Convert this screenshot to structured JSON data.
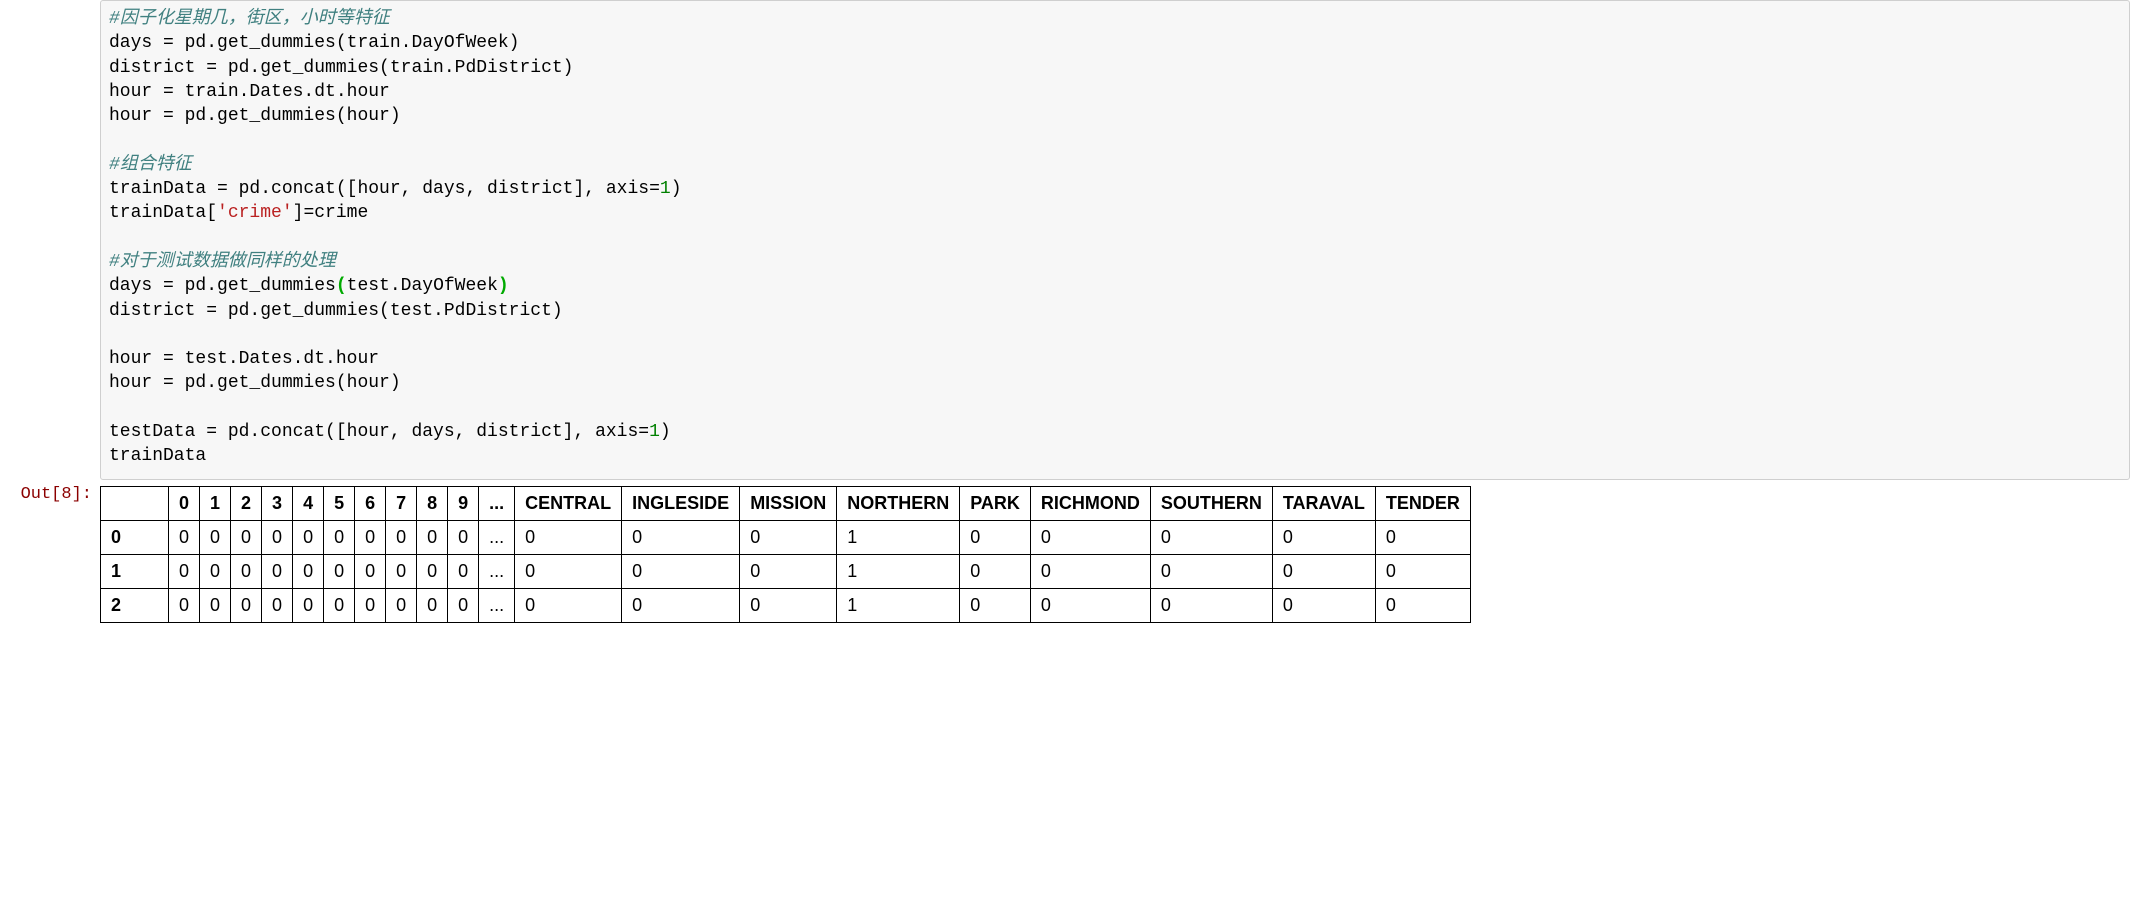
{
  "code": {
    "lines": [
      {
        "type": "comment",
        "text": "#因子化星期几，街区，小时等特征"
      },
      {
        "type": "plain",
        "text": "days = pd.get_dummies(train.DayOfWeek)"
      },
      {
        "type": "plain",
        "text": "district = pd.get_dummies(train.PdDistrict)"
      },
      {
        "type": "plain",
        "text": "hour = train.Dates.dt.hour"
      },
      {
        "type": "plain",
        "text": "hour = pd.get_dummies(hour)"
      },
      {
        "type": "blank",
        "text": ""
      },
      {
        "type": "comment",
        "text": "#组合特征"
      },
      {
        "type": "concat1",
        "pre": "trainData = pd.concat([hour, days, district], axis=",
        "num": "1",
        "post": ")"
      },
      {
        "type": "crime",
        "pre": "trainData[",
        "str": "'crime'",
        "post": "]=crime"
      },
      {
        "type": "blank",
        "text": ""
      },
      {
        "type": "comment",
        "text": "#对于测试数据做同样的处理"
      },
      {
        "type": "hlparen",
        "pre": "days = pd.get_dummies",
        "open": "(",
        "mid": "test.DayOfWeek",
        "close": ")"
      },
      {
        "type": "plain",
        "text": "district = pd.get_dummies(test.PdDistrict)"
      },
      {
        "type": "blank",
        "text": ""
      },
      {
        "type": "plain",
        "text": "hour = test.Dates.dt.hour"
      },
      {
        "type": "plain",
        "text": "hour = pd.get_dummies(hour)"
      },
      {
        "type": "blank",
        "text": ""
      },
      {
        "type": "concat1",
        "pre": "testData = pd.concat([hour, days, district], axis=",
        "num": "1",
        "post": ")"
      },
      {
        "type": "plain",
        "text": "trainData"
      }
    ]
  },
  "output": {
    "prompt": "Out[8]:",
    "columns": [
      "0",
      "1",
      "2",
      "3",
      "4",
      "5",
      "6",
      "7",
      "8",
      "9",
      "...",
      "CENTRAL",
      "INGLESIDE",
      "MISSION",
      "NORTHERN",
      "PARK",
      "RICHMOND",
      "SOUTHERN",
      "TARAVAL",
      "TENDER"
    ],
    "rows": [
      {
        "index": "0",
        "cells": [
          "0",
          "0",
          "0",
          "0",
          "0",
          "0",
          "0",
          "0",
          "0",
          "0",
          "...",
          "0",
          "0",
          "0",
          "1",
          "0",
          "0",
          "0",
          "0",
          "0"
        ]
      },
      {
        "index": "1",
        "cells": [
          "0",
          "0",
          "0",
          "0",
          "0",
          "0",
          "0",
          "0",
          "0",
          "0",
          "...",
          "0",
          "0",
          "0",
          "1",
          "0",
          "0",
          "0",
          "0",
          "0"
        ]
      },
      {
        "index": "2",
        "cells": [
          "0",
          "0",
          "0",
          "0",
          "0",
          "0",
          "0",
          "0",
          "0",
          "0",
          "...",
          "0",
          "0",
          "0",
          "1",
          "0",
          "0",
          "0",
          "0",
          "0"
        ]
      }
    ]
  }
}
